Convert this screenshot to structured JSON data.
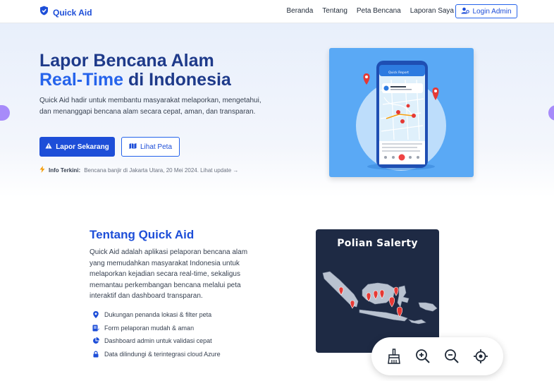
{
  "brand": {
    "name": "Quick Aid"
  },
  "nav": {
    "links": [
      "Beranda",
      "Tentang",
      "Peta Bencana",
      "Laporan Saya"
    ],
    "login_label": "Login Admin"
  },
  "hero": {
    "title_line1": "Lapor Bencana Alam",
    "title_accent": "Real-Time",
    "title_rest": " di Indonesia",
    "description": "Quick Aid hadir untuk membantu masyarakat melaporkan, mengetahui, dan menanggapi bencana alam secara cepat, aman, dan transparan.",
    "primary_button": "Lapor Sekarang",
    "secondary_button": "Lihat Peta",
    "info_label": "Info Terkini:",
    "info_text": "Bencana banjir di Jakarta Utara, 20 Mei 2024. Lihat update →",
    "phone_app_title": "Quick Report"
  },
  "about": {
    "title": "Tentang Quick Aid",
    "description": "Quick Aid adalah aplikasi pelaporan bencana alam yang memudahkan masyarakat Indonesia untuk melaporkan kejadian secara real-time, sekaligus memantau perkembangan bencana melalui peta interaktif dan dashboard transparan.",
    "features": [
      "Dukungan penanda lokasi & filter peta",
      "Form pelaporan mudah & aman",
      "Dashboard admin untuk validasi cepat",
      "Data dilindungi & terintegrasi cloud Azure"
    ],
    "map_card_title": "Polian Salerty"
  },
  "toolbar": {
    "tools": [
      "broom-icon",
      "zoom-in-icon",
      "zoom-out-icon",
      "locate-icon"
    ]
  },
  "colors": {
    "primary": "#1d4ed8",
    "accent": "#2563eb",
    "hero_bg": "#e8effb",
    "card_blue": "#5aa9f5",
    "map_bg": "#1e2a44",
    "pin_red": "#e53935"
  }
}
